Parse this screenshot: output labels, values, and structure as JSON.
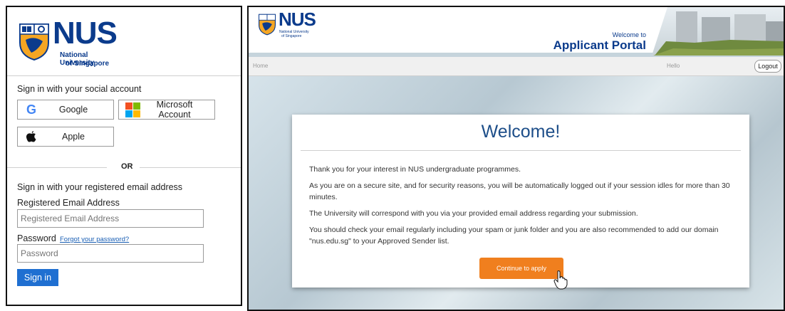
{
  "left": {
    "brand": {
      "name": "NUS",
      "line1": "National University",
      "line2": "of Singapore"
    },
    "social_title": "Sign in with your social account",
    "social_buttons": [
      {
        "label": "Google",
        "icon": "google-icon"
      },
      {
        "label": "Microsoft Account",
        "icon": "microsoft-icon"
      },
      {
        "label": "Apple",
        "icon": "apple-icon"
      }
    ],
    "or_text": "OR",
    "registered_title": "Sign in with your registered email address",
    "email_label": "Registered Email Address",
    "email_placeholder": "Registered Email Address",
    "password_label": "Password",
    "forgot_link": "Forgot your password?",
    "password_placeholder": "Password",
    "signin_label": "Sign in"
  },
  "right": {
    "brand": {
      "name": "NUS",
      "line1": "National University",
      "line2": "of Singapore"
    },
    "welcome_to": "Welcome to",
    "portal_title": "Applicant Portal",
    "nav": {
      "home": "Home",
      "hello": "Hello",
      "logout": "Logout"
    },
    "card": {
      "title": "Welcome!",
      "paragraphs": [
        "Thank you for your interest in NUS undergraduate programmes.",
        "As you are on a secure site, and for security reasons, you will be automatically logged out if your session idles for more than 30 minutes.",
        "The University will correspond with you via your provided email address regarding your submission.",
        "You should check your email regularly including your spam or junk folder and you are also recommended to add our domain \"nus.edu.sg\" to your Approved Sender list."
      ],
      "continue_label": "Continue to apply"
    }
  },
  "colors": {
    "nus_blue": "#0b3b8c",
    "signin_blue": "#1f6fd1",
    "continue_orange": "#f07f1e",
    "welcome_blue": "#1d4e89"
  }
}
